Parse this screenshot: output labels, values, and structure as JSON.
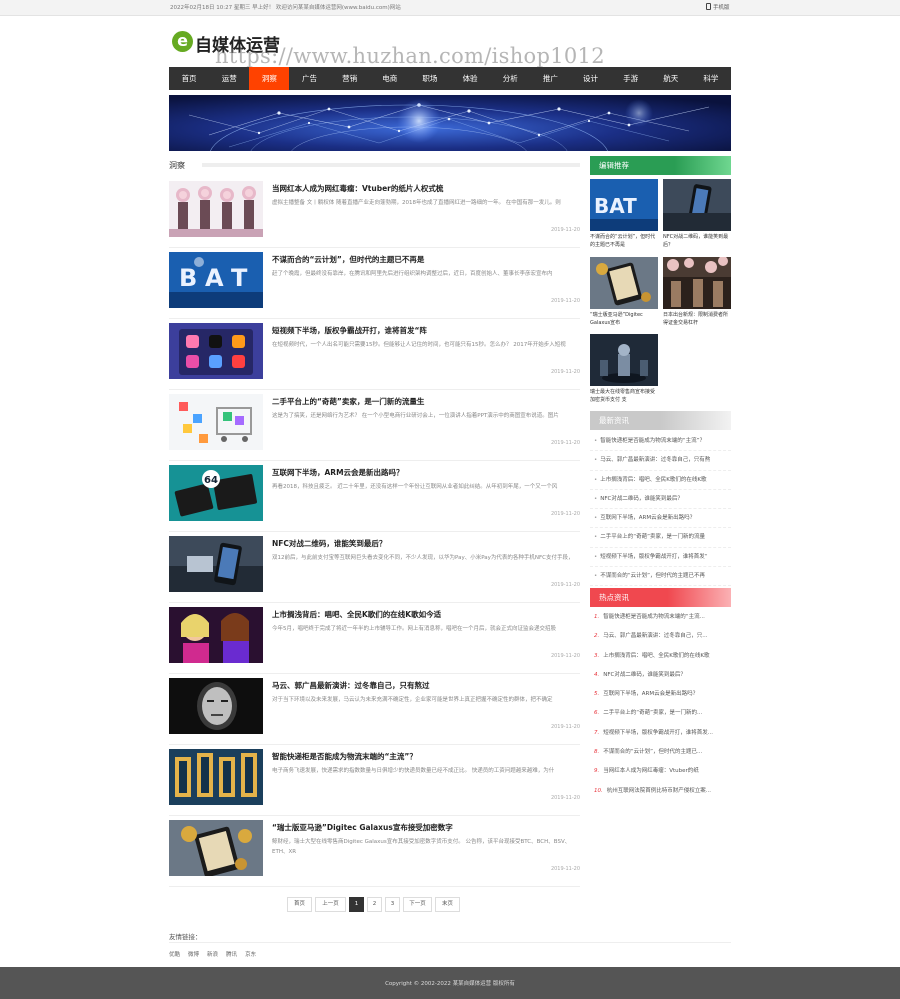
{
  "topbar": {
    "date_text": "2022年02月18日 10:27 星期三 早上好！ 欢迎访问某某自媒体运营网(www.baidu.com)网站",
    "mobile_label": "手机版"
  },
  "logo": {
    "letter": "e",
    "name": "自媒体运营"
  },
  "watermark": "https://www.huzhan.com/ishop1012",
  "nav": {
    "items": [
      "首页",
      "运营",
      "洞察",
      "广告",
      "营销",
      "电商",
      "职场",
      "体验",
      "分析",
      "推广",
      "设计",
      "手游",
      "航天",
      "科学"
    ],
    "active_index": 2
  },
  "section": {
    "title": "洞察"
  },
  "articles": [
    {
      "title": "当网红本人成为网红毒瘤：Vtuber的纸片人权式梳",
      "desc": "虚拟主播整备 文丨躺权体 随着直播产业走向蓬勃期，2018年也成了直播网红进一路细的一年。 在中国有那一发儿。则",
      "date": "2019-11-20"
    },
    {
      "title": "不谋而合的“云计划”，但时代的主题已不再是",
      "desc": "赶了个晚霞，但最终没有靠岸，在腾讯和阿里先后进行组织架构调整过后，近日，百度创始人、董事长李彦宏宣布内",
      "date": "2019-11-20"
    },
    {
      "title": "短视频下半场，版权争霸战开打，谁将首发“阵",
      "desc": "在短视频时代，一个人出名可能只需要15秒。但能够让人记住的时间，也可能只有15秒。怎么办？ 2017年开始步入短视",
      "date": "2019-11-20"
    },
    {
      "title": "二手平台上的“奇葩”卖家，是一门新的流量生",
      "desc": "这是为了搞笑，还是网络行为艺术？ 在一个小型电商行业研讨会上，一位演讲人指着PPT演示中的商图宣布说道。图片",
      "date": "2019-11-20"
    },
    {
      "title": "互联网下半场，ARM云会是新出路吗？",
      "desc": "再看2018，科技且疲乏。 近二十年里，还没有这样一个年份让互联网从业者如此纠结。从年初到年尾，一个又一个风",
      "date": "2019-11-20"
    },
    {
      "title": "NFC对战二维码，谁能笑到最后？",
      "desc": "双12前后，与此前支付宝等互联网巨头看去变化不同，不少人发现，以华为Pay、小米Pay为代表的各种手机NFC支付手段，",
      "date": "2019-11-20"
    },
    {
      "title": "上市搁浅背后：唱吧、全民K歌们的在线K歌如今适",
      "desc": "今年5月，唱吧终于完成了将近一年半的上市辅导工作。网上有消息称，唱吧在一个月后，就会正式向证监会递交招股",
      "date": "2019-11-20"
    },
    {
      "title": "马云、郭广昌最新演讲：过冬靠自己，只有熬过",
      "desc": "对于当下环境以及未来发展，马云认为未来充满不确定性，企业家可能是世界上真正把握不确定性的群体，把不确定",
      "date": "2019-11-20"
    },
    {
      "title": "智能快递柜是否能成为物流末端的“主流”？",
      "desc": "电子商务飞速发展，快递需求的指数数量与日俱增少的快递员数量已经不成正比。 快递员的工资问题越来越难，为什",
      "date": "2019-11-20"
    },
    {
      "title": "“瑞士版亚马逊”Digitec Galaxus宣布接受加密数字",
      "desc": "鲸财经，瑞士大型在线零售商Digitec Galaxus宣布其接受加密数字货币支付。 公告称，该平台现接受BTC、BCH、BSV、ETH、XR",
      "date": "2019-11-20"
    }
  ],
  "pager": {
    "items": [
      "首页",
      "上一页",
      "1",
      "2",
      "3",
      "下一页",
      "末页"
    ],
    "current": "1"
  },
  "links": {
    "title": "友情链接：",
    "items": [
      "优酷",
      "微博",
      "新浪",
      "腾讯",
      "京东"
    ]
  },
  "footer": {
    "copyright": "Copyright © 2002-2022 某某自媒体运营 版权所有"
  },
  "sidebar": {
    "recommend_title": "编辑推荐",
    "recommend": [
      "不谋而合的“云计划”，但时代的主题已不再是",
      "NFC对战二维码，谁能笑到最后？",
      "“瑞士版亚马逊”Digitec Galaxus宣布",
      "日本出台新规：限制消费者所得证金交易杠杆",
      "瑞士最大在线零售商宣布接受加密货币支付 支"
    ],
    "latest_title": "最新资讯",
    "latest": [
      "智能快递柜是否能成为物流末端的“主流”？",
      "马云、郭广昌最新演讲：过冬靠自己，只有熬",
      "上市搁浅背后：唱吧、全民K歌们的在线K歌",
      "NFC对战二维码，谁能笑到最后？",
      "互联网下半场，ARM云会是新出路吗？",
      "二手平台上的“奇葩”卖家，是一门新的流量",
      "短视频下半场，版权争霸战开打，谁将首发“",
      "不谋而合的“云计划”，但时代的主题已不再"
    ],
    "hot_title": "热点资讯",
    "hot": [
      "智能快递柜是否能成为物流末端的“主流...",
      "马云、郭广昌最新演讲：过冬靠自己，只...",
      "上市搁浅背后：唱吧、全民K歌们的在线K歌",
      "NFC对战二维码，谁能笑到最后？",
      "互联网下半场，ARM云会是新出路吗？",
      "二手平台上的“奇葩”卖家，是一门新的...",
      "短视频下半场，版权争霸战开打，谁将首发...",
      "不谋而合的“云计划”，但时代的主题已...",
      "当网红本人成为网红毒瘤：Vtuber的纸",
      "杭州互联网法院首例比特币财产侵权立案..."
    ]
  },
  "colors": {
    "nav_bg": "#333333",
    "nav_active": "#ff4200",
    "green": "#2a9d54",
    "red": "#f0484f",
    "footer_bg": "#555555"
  }
}
